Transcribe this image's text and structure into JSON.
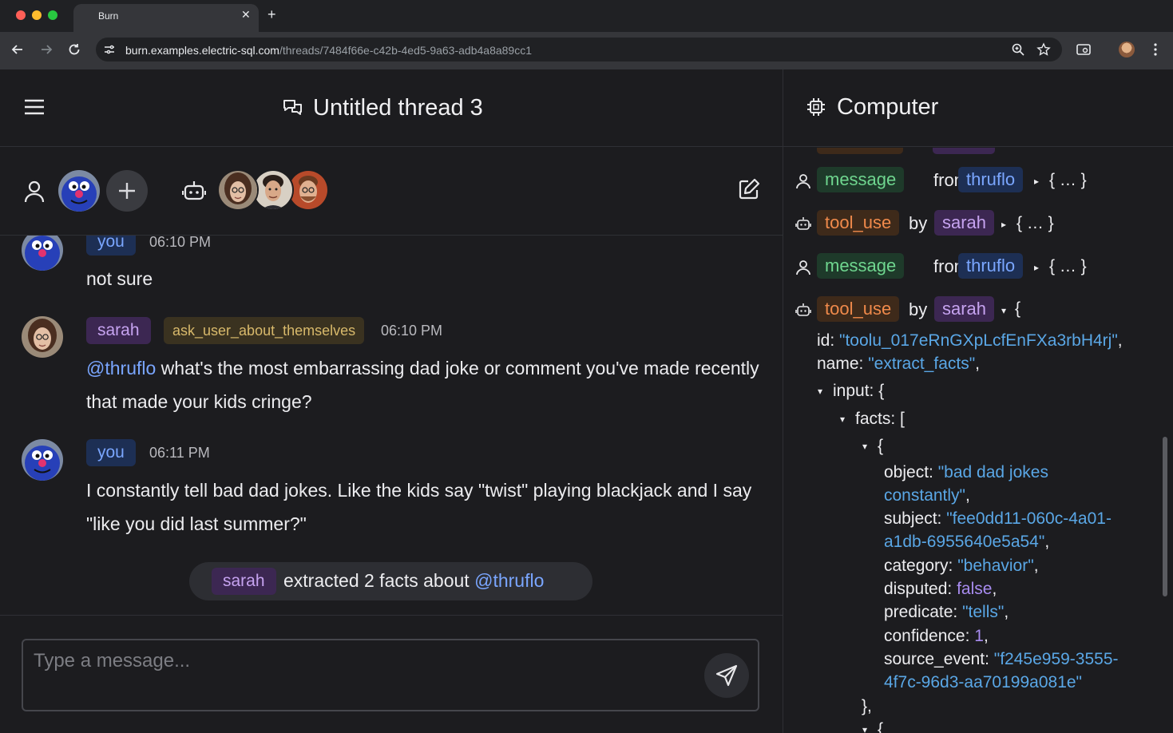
{
  "browser": {
    "tab_title": "Burn",
    "tab_close": "✕",
    "new_tab": "+",
    "url_domain": "burn.examples.electric-sql.com",
    "url_path": "/threads/7484f66e-c42b-4ed5-9a63-adb4a8a89cc1"
  },
  "thread": {
    "title": "Untitled thread 3"
  },
  "messages": [
    {
      "sender": "you",
      "time": "06:10 PM",
      "text": "not sure"
    },
    {
      "sender": "sarah",
      "tool": "ask_user_about_themselves",
      "time": "06:10 PM",
      "mention": "@thruflo",
      "text": " what's the most embarrassing dad joke or comment you've made recently that made your kids cringe?"
    },
    {
      "sender": "you",
      "time": "06:11 PM",
      "text": "I constantly tell bad dad jokes. Like the kids say \"twist\" playing blackjack and I say \"like you did last summer?\""
    }
  ],
  "extracted": {
    "agent": "sarah",
    "text": "extracted 2 facts about ",
    "mention": "@thruflo"
  },
  "composer": {
    "placeholder": "Type a message..."
  },
  "computer": {
    "title": "Computer",
    "events": [
      {
        "type": "message",
        "connector": "from",
        "actor": "thruflo",
        "collapsed": "{ … }"
      },
      {
        "type": "tool_use",
        "connector": "by",
        "actor": "sarah",
        "collapsed": "{ … }"
      },
      {
        "type": "message",
        "connector": "from",
        "actor": "thruflo",
        "collapsed": "{ … }"
      },
      {
        "type": "tool_use",
        "connector": "by",
        "actor": "sarah",
        "expanded_open": "{"
      }
    ],
    "json": {
      "id_key": "id: ",
      "id_val": "\"toolu_017eRnGXpLcfEnFXa3rbH4rj\"",
      "name_key": "name: ",
      "name_val": "\"extract_facts\"",
      "input_key": "input: {",
      "facts_key": "facts: [",
      "obj_open": "{",
      "object_key": "object: ",
      "object_val_1": "\"bad dad jokes",
      "object_val_2": "constantly\"",
      "subject_key": "subject: ",
      "subject_val_1": "\"fee0dd11-060c-4a01-",
      "subject_val_2": "a1db-6955640e5a54\"",
      "category_key": "category: ",
      "category_val": "\"behavior\"",
      "disputed_key": "disputed: ",
      "disputed_val": "false",
      "predicate_key": "predicate: ",
      "predicate_val": "\"tells\"",
      "confidence_key": "confidence: ",
      "confidence_val": "1",
      "source_key": "source_event: ",
      "source_val_1": "\"f245e959-3555-",
      "source_val_2": "4f7c-96d3-aa70199a081e\"",
      "obj_close": "},",
      "next_open": "{"
    }
  }
}
